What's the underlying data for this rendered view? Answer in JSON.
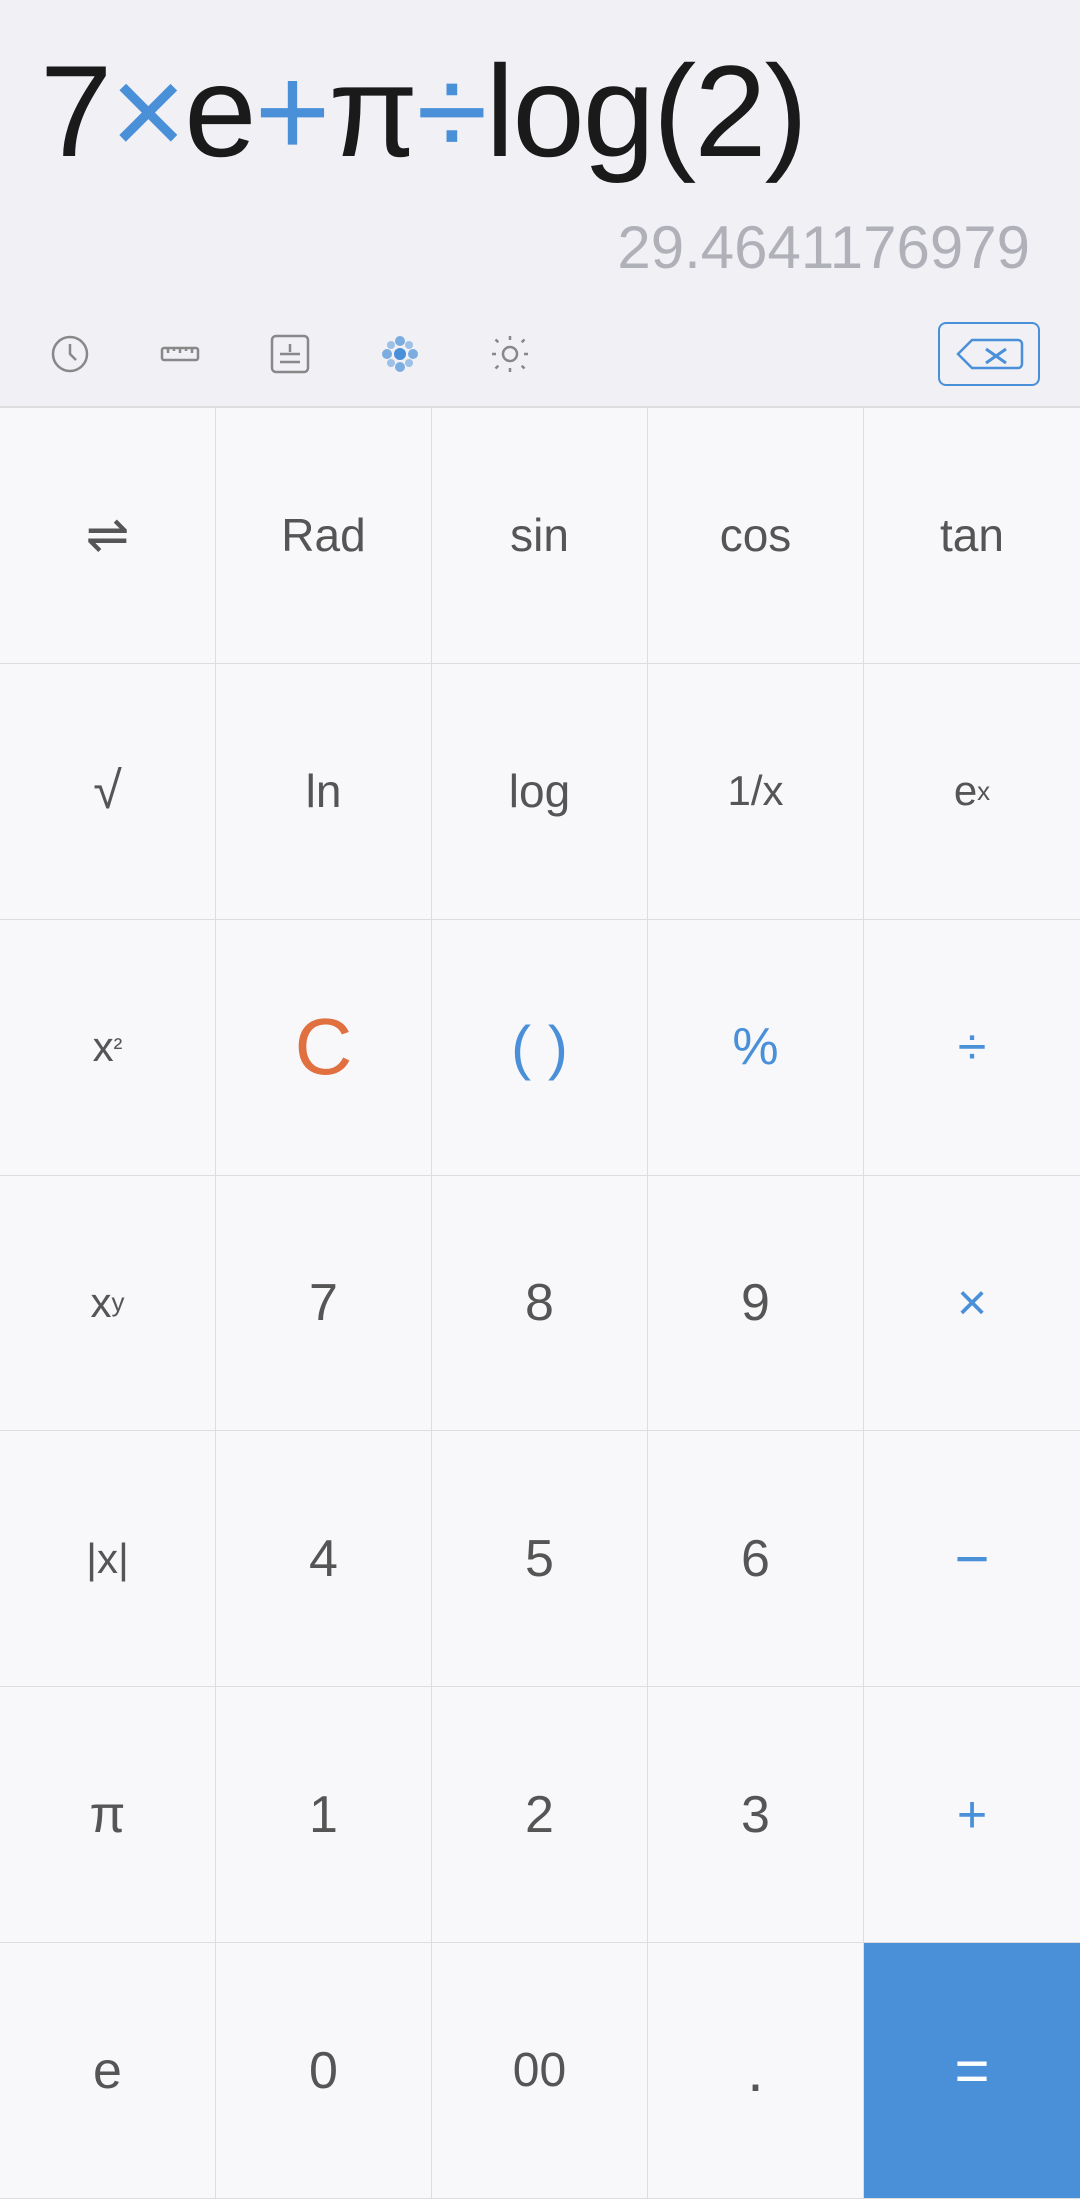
{
  "display": {
    "expression_parts": [
      {
        "text": "7",
        "style": "normal"
      },
      {
        "text": "×",
        "style": "blue"
      },
      {
        "text": "e",
        "style": "normal"
      },
      {
        "text": "+",
        "style": "blue"
      },
      {
        "text": "π",
        "style": "normal"
      },
      {
        "text": "÷",
        "style": "blue"
      },
      {
        "text": "log(2)",
        "style": "normal"
      }
    ],
    "expression_html": "7<span class=\"blue-op\">×</span>e<span class=\"blue-op\">+</span>π<span class=\"blue-op\">÷</span>log(2)",
    "result": "29.4641176979"
  },
  "toolbar": {
    "history_title": "History",
    "ruler_title": "Unit converter",
    "plusminus_title": "Toggle sign",
    "theme_title": "Theme",
    "settings_title": "Settings",
    "backspace_title": "Backspace"
  },
  "keypad": {
    "rows": [
      [
        {
          "label": "⇌",
          "name": "convert",
          "style": "normal"
        },
        {
          "label": "Rad",
          "name": "rad",
          "style": "normal"
        },
        {
          "label": "sin",
          "name": "sin",
          "style": "normal"
        },
        {
          "label": "cos",
          "name": "cos",
          "style": "normal"
        },
        {
          "label": "tan",
          "name": "tan",
          "style": "normal"
        }
      ],
      [
        {
          "label": "√",
          "name": "sqrt",
          "style": "normal"
        },
        {
          "label": "ln",
          "name": "ln",
          "style": "normal"
        },
        {
          "label": "log",
          "name": "log",
          "style": "normal"
        },
        {
          "label": "1/x",
          "name": "reciprocal",
          "style": "normal"
        },
        {
          "label": "ex",
          "name": "exp",
          "style": "superscript",
          "base": "e",
          "sup": "x"
        }
      ],
      [
        {
          "label": "x²",
          "name": "square",
          "style": "superscript",
          "base": "x",
          "sup": "²"
        },
        {
          "label": "C",
          "name": "clear",
          "style": "orange"
        },
        {
          "label": "()",
          "name": "parens",
          "style": "blue"
        },
        {
          "label": "%",
          "name": "percent",
          "style": "blue"
        },
        {
          "label": "÷",
          "name": "divide",
          "style": "blue"
        }
      ],
      [
        {
          "label": "xʸ",
          "name": "power",
          "style": "superscript",
          "base": "x",
          "sup": "y"
        },
        {
          "label": "7",
          "name": "seven",
          "style": "normal"
        },
        {
          "label": "8",
          "name": "eight",
          "style": "normal"
        },
        {
          "label": "9",
          "name": "nine",
          "style": "normal"
        },
        {
          "label": "×",
          "name": "multiply",
          "style": "blue"
        }
      ],
      [
        {
          "label": "|x|",
          "name": "abs",
          "style": "normal"
        },
        {
          "label": "4",
          "name": "four",
          "style": "normal"
        },
        {
          "label": "5",
          "name": "five",
          "style": "normal"
        },
        {
          "label": "6",
          "name": "six",
          "style": "normal"
        },
        {
          "label": "−",
          "name": "minus",
          "style": "blue"
        }
      ],
      [
        {
          "label": "π",
          "name": "pi",
          "style": "normal"
        },
        {
          "label": "1",
          "name": "one",
          "style": "normal"
        },
        {
          "label": "2",
          "name": "two",
          "style": "normal"
        },
        {
          "label": "3",
          "name": "three",
          "style": "normal"
        },
        {
          "label": "+",
          "name": "plus",
          "style": "blue"
        }
      ],
      [
        {
          "label": "e",
          "name": "euler",
          "style": "normal"
        },
        {
          "label": "0",
          "name": "zero",
          "style": "normal"
        },
        {
          "label": "00",
          "name": "double-zero",
          "style": "normal"
        },
        {
          "label": ".",
          "name": "decimal",
          "style": "normal"
        },
        {
          "label": "=",
          "name": "equals",
          "style": "equals"
        }
      ]
    ]
  },
  "colors": {
    "blue": "#4a90d9",
    "orange": "#e07040",
    "bg": "#f0f0f5",
    "key_bg": "#f8f8fa",
    "border": "#ddd",
    "text_normal": "#555",
    "text_light": "#b0b0b8"
  }
}
